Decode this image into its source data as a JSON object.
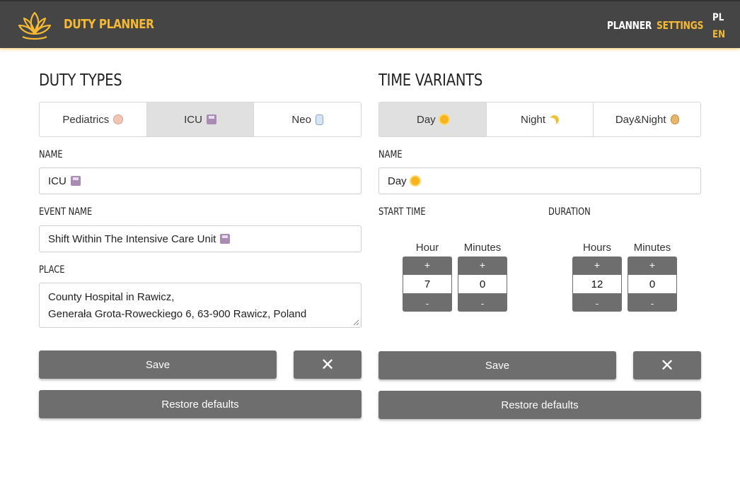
{
  "header": {
    "brand": "DUTY PLANNER",
    "logo_icon": "lotus-icon",
    "nav": {
      "planner": "PLANNER",
      "settings": "SETTINGS"
    },
    "languages": {
      "pl": "PL",
      "en": "EN"
    },
    "colors": {
      "bar": "#454545",
      "accent": "#f5b933",
      "active_lang": "EN"
    }
  },
  "duty_types": {
    "title": "DUTY TYPES",
    "tabs": [
      {
        "label": "Pediatrics",
        "icon": "baby-emoji-icon"
      },
      {
        "label": "ICU",
        "icon": "floppy-disk-emoji-icon",
        "active": true
      },
      {
        "label": "Neo",
        "icon": "nurse-emoji-icon"
      }
    ],
    "name_label": "NAME",
    "name_value": "ICU",
    "event_name_label": "EVENT NAME",
    "event_name_value": "Shift Within The Intensive Care Unit",
    "place_label": "PLACE",
    "place_line1": "County Hospital in Rawicz,",
    "place_line2": "Generała Grota-Roweckiego 6, 63-900 Rawicz, Poland",
    "save_label": "Save",
    "close_icon": "close-icon",
    "restore_label": "Restore defaults"
  },
  "time_variants": {
    "title": "TIME VARIANTS",
    "tabs": [
      {
        "label": "Day",
        "icon": "sun-emoji-icon",
        "active": true
      },
      {
        "label": "Night",
        "icon": "moon-emoji-icon"
      },
      {
        "label": "Day&Night",
        "icon": "money-bag-emoji-icon"
      }
    ],
    "name_label": "NAME",
    "name_value": "Day",
    "start_time_label": "START TIME",
    "duration_label": "DURATION",
    "start": {
      "hour_label": "Hour",
      "hour_value": "7",
      "minutes_label": "Minutes",
      "minutes_value": "0"
    },
    "duration": {
      "hours_label": "Hours",
      "hours_value": "12",
      "minutes_label": "Minutes",
      "minutes_value": "0"
    },
    "plus": "+",
    "minus": "-",
    "save_label": "Save",
    "close_icon": "close-icon",
    "restore_label": "Restore defaults"
  }
}
